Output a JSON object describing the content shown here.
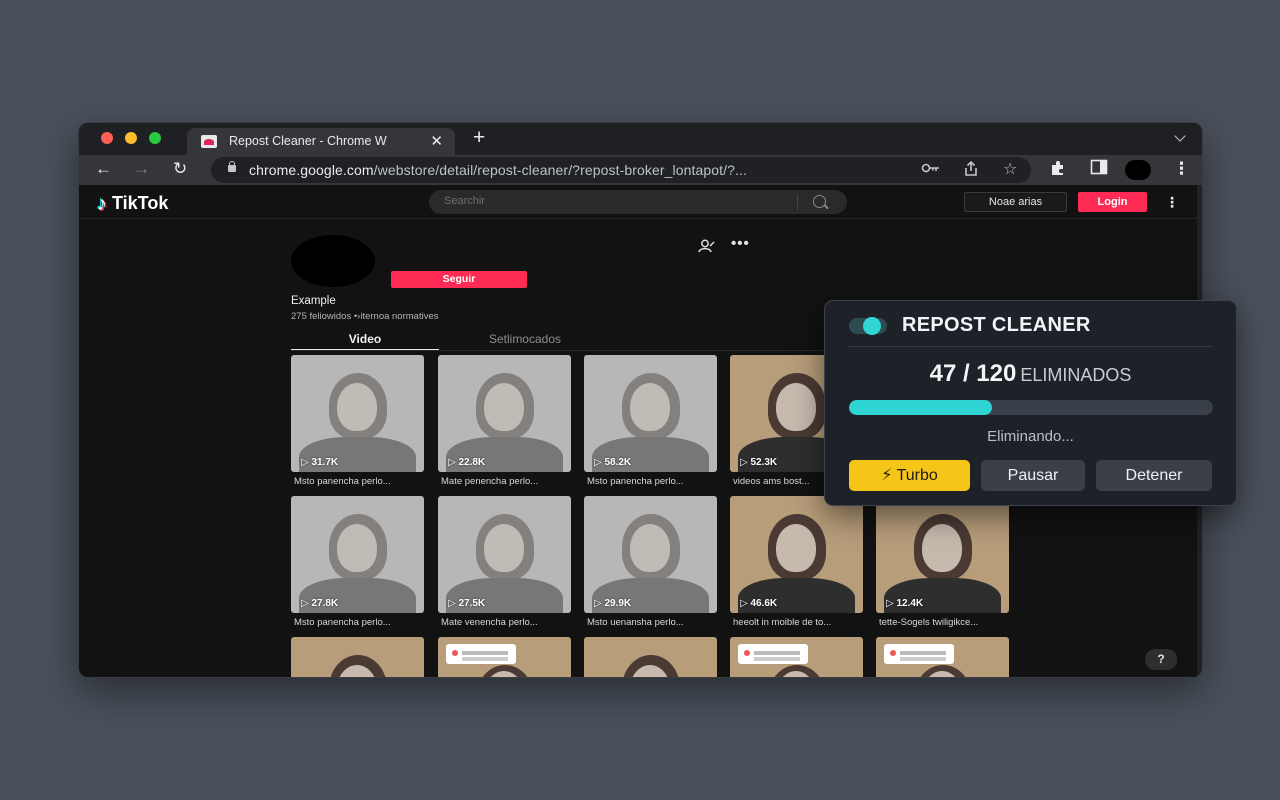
{
  "browser": {
    "tab_title": "Repost Cleaner - Chrome W",
    "tab_close": "✕",
    "new_tab": "+",
    "url_host": "chrome.google.com",
    "url_path": "/webstore/detail/repost-cleaner/?repost-broker_lontapot/?...",
    "icons": [
      "back-icon",
      "forward-icon",
      "reload-icon",
      "key-icon",
      "share-icon",
      "star-icon",
      "extensions-icon",
      "sidepanel-icon",
      "menu-icon"
    ]
  },
  "tiktok": {
    "logo": "TikTok",
    "search_placeholder": "Searchir",
    "upload_label": "Noae arias",
    "login_label": "Login",
    "follow_label": "Seguir",
    "profile_name": "Example",
    "profile_stats": "275 feliowidos  •›iternoa normatives",
    "tab_video": "Video",
    "tab_liked": "Setlimocados",
    "help": "?"
  },
  "videos": [
    {
      "views": "31.7K",
      "caption": "Msto panencha perlo...",
      "style": "gray"
    },
    {
      "views": "22.8K",
      "caption": "Mate penencha perlo...",
      "style": "gray"
    },
    {
      "views": "58.2K",
      "caption": "Msto panencha perlo...",
      "style": "gray"
    },
    {
      "views": "52.3K",
      "caption": "videos ams bost...",
      "style": "color"
    },
    {
      "views": "27.8K",
      "caption": "Msto panencha perlo...",
      "style": "gray"
    },
    {
      "views": "27.5K",
      "caption": "Mate venencha perlo...",
      "style": "gray"
    },
    {
      "views": "29.9K",
      "caption": "Msto uenansha perlo...",
      "style": "gray"
    },
    {
      "views": "46.6K",
      "caption": "heeolt in moible de to...",
      "style": "color"
    },
    {
      "views": "12.4K",
      "caption": "tette-Sogels twiligikce...",
      "style": "color"
    },
    {
      "views": "",
      "caption": "",
      "style": "color"
    },
    {
      "views": "",
      "caption": "",
      "style": "color"
    },
    {
      "views": "",
      "caption": "",
      "style": "color"
    },
    {
      "views": "",
      "caption": "",
      "style": "color"
    },
    {
      "views": "",
      "caption": "",
      "style": "color"
    }
  ],
  "extension": {
    "title": "REPOST CLEANER",
    "toggle_on": true,
    "count_text": "47 / 120",
    "count_label": "ELIMINADOS",
    "progress": 0.3917,
    "status": "Eliminando...",
    "turbo_label": "Turbo",
    "turbo_icon": "⚡",
    "pause_label": "Pausar",
    "stop_label": "Detener",
    "colors": {
      "accent": "#2fd4d4",
      "turbo": "#f5c518",
      "panel": "#1e2128"
    }
  }
}
